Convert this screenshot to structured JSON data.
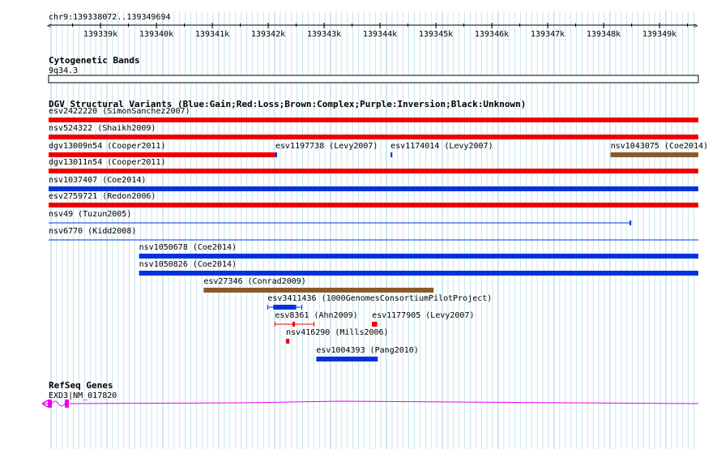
{
  "ruler": {
    "range_label": "chr9:139338072..139349694",
    "start": 139338072,
    "end": 139349694,
    "ticks": [
      "139339k",
      "139340k",
      "139341k",
      "139342k",
      "139343k",
      "139344k",
      "139345k",
      "139346k",
      "139347k",
      "139348k",
      "139349k"
    ]
  },
  "tracks": {
    "cytoband": {
      "title": "Cytogenetic Bands",
      "band_label": "9q34.3"
    },
    "dgv": {
      "title": "DGV Structural Variants (Blue:Gain;Red:Loss;Brown:Complex;Purple:Inversion;Black:Unknown)",
      "legend": {
        "Gain": "#0033dd",
        "Loss": "#ee0000",
        "Complex": "#8b5a2b",
        "Inversion": "#800080",
        "Unknown": "#000000"
      },
      "features": [
        {
          "id": "esv2422220",
          "ref": "SimonSanchez2007",
          "type": "Loss",
          "label": "esv2422220 (SimonSanchez2007)",
          "start": 139338072,
          "end": 139349694
        },
        {
          "id": "nsv524322",
          "ref": "Shaikh2009",
          "type": "Loss",
          "label": "nsv524322 (Shaikh2009)",
          "start": 139338072,
          "end": 139349694
        },
        {
          "id": "dgv13009n54",
          "ref": "Cooper2011",
          "type": "Loss",
          "label": "dgv13009n54 (Cooper2011)",
          "start": 139338072,
          "end": 139342145
        },
        {
          "id": "esv1197738",
          "ref": "Levy2007",
          "type": "Gain",
          "label": "esv1197738 (Levy2007)",
          "start": 139342130,
          "end": 139342160
        },
        {
          "id": "esv1174014",
          "ref": "Levy2007",
          "type": "Gain",
          "label": "esv1174014 (Levy2007)",
          "start": 139344190,
          "end": 139344220
        },
        {
          "id": "nsv1043075",
          "ref": "Coe2014",
          "type": "Complex",
          "label": "nsv1043075 (Coe2014)",
          "start": 139348125,
          "end": 139349694
        },
        {
          "id": "dgv13011n54",
          "ref": "Cooper2011",
          "type": "Loss",
          "label": "dgv13011n54 (Cooper2011)",
          "start": 139338072,
          "end": 139349694
        },
        {
          "id": "nsv1037407",
          "ref": "Coe2014",
          "type": "Gain",
          "label": "nsv1037407 (Coe2014)",
          "start": 139338072,
          "end": 139349694
        },
        {
          "id": "esv2759721",
          "ref": "Redon2006",
          "type": "Loss",
          "label": "esv2759721 (Redon2006)",
          "start": 139338072,
          "end": 139349694
        },
        {
          "id": "nsv49",
          "ref": "Tuzun2005",
          "type": "Gain",
          "label": "nsv49 (Tuzun2005)",
          "start": 139338072,
          "end": 139348480
        },
        {
          "id": "nsv6770",
          "ref": "Kidd2008",
          "type": "Gain",
          "label": "nsv6770 (Kidd2008)",
          "start": 139338072,
          "end": 139349694
        },
        {
          "id": "nsv1050678",
          "ref": "Coe2014",
          "type": "Gain",
          "label": "nsv1050678 (Coe2014)",
          "start": 139339690,
          "end": 139349694
        },
        {
          "id": "nsv1050826",
          "ref": "Coe2014",
          "type": "Gain",
          "label": "nsv1050826 (Coe2014)",
          "start": 139339690,
          "end": 139349694
        },
        {
          "id": "esv27346",
          "ref": "Conrad2009",
          "type": "Complex",
          "label": "esv27346 (Conrad2009)",
          "start": 139340845,
          "end": 139344960
        },
        {
          "id": "esv3411436",
          "ref": "1000GenomesConsortiumPilotProject",
          "type": "Gain",
          "label": "esv3411436 (1000GenomesConsortiumPilotProject)",
          "start": 139341990,
          "end": 139342600
        },
        {
          "id": "esv8361",
          "ref": "Ahn2009",
          "type": "Loss",
          "label": "esv8361 (Ahn2009)",
          "start": 139342120,
          "end": 139342820
        },
        {
          "id": "esv1177905",
          "ref": "Levy2007",
          "type": "Loss",
          "label": "esv1177905 (Levy2007)",
          "start": 139343855,
          "end": 139343950
        },
        {
          "id": "nsv416290",
          "ref": "Mills2006",
          "type": "Loss",
          "label": "nsv416290 (Mills2006)",
          "start": 139342320,
          "end": 139342380
        },
        {
          "id": "esv1004393",
          "ref": "Pang2010",
          "type": "Gain",
          "label": "esv1004393 (Pang2010)",
          "start": 139342860,
          "end": 139343960
        }
      ]
    },
    "refseq": {
      "title": "RefSeq Genes",
      "gene_label": "EXD3|NM_017820",
      "color": "#ee00ee"
    }
  }
}
